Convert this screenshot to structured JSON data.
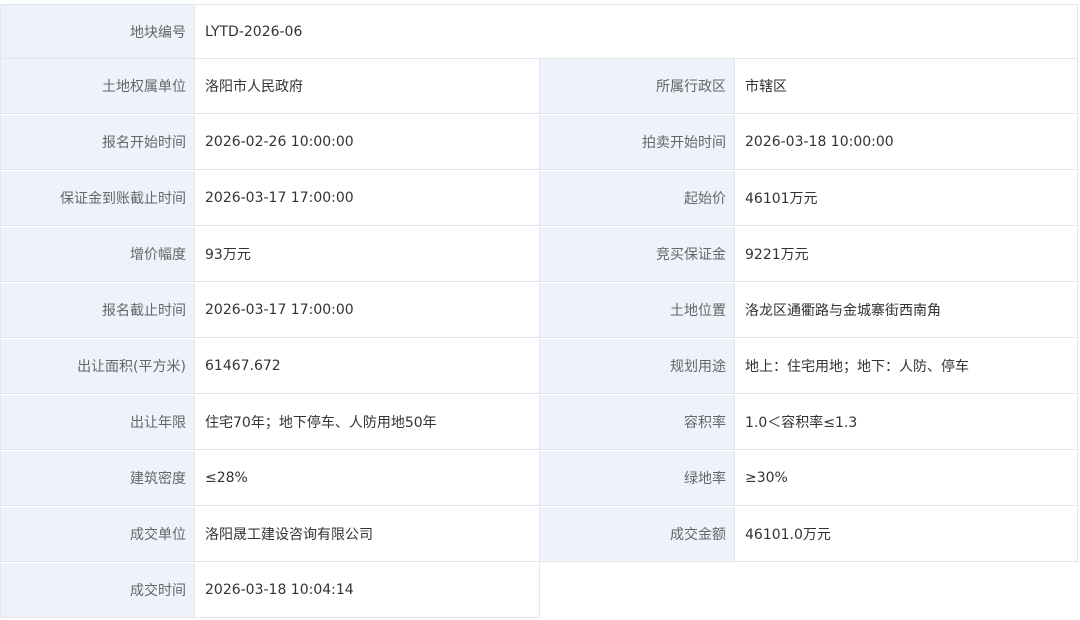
{
  "rows": [
    {
      "label": "地块编号",
      "value": "LYTD-2026-06"
    },
    {
      "label1": "土地权属单位",
      "value1": "洛阳市人民政府",
      "label2": "所属行政区",
      "value2": "市辖区"
    },
    {
      "label1": "报名开始时间",
      "value1": "2026-02-26 10:00:00",
      "label2": "拍卖开始时间",
      "value2": "2026-03-18 10:00:00"
    },
    {
      "label1": "保证金到账截止时间",
      "value1": "2026-03-17 17:00:00",
      "label2": "起始价",
      "value2": "46101万元"
    },
    {
      "label1": "增价幅度",
      "value1": "93万元",
      "label2": "竞买保证金",
      "value2": "9221万元"
    },
    {
      "label1": "报名截止时间",
      "value1": "2026-03-17 17:00:00",
      "label2": "土地位置",
      "value2": "洛龙区通衢路与金城寨街西南角"
    },
    {
      "label1": "出让面积(平方米)",
      "value1": "61467.672",
      "label2": "规划用途",
      "value2": "地上：住宅用地；地下：人防、停车"
    },
    {
      "label1": "出让年限",
      "value1": "住宅70年；地下停车、人防用地50年",
      "label2": "容积率",
      "value2": "1.0＜容积率≤1.3"
    },
    {
      "label1": "建筑密度",
      "value1": "≤28%",
      "label2": "绿地率",
      "value2": "≥30%"
    },
    {
      "label1": "成交单位",
      "value1": "洛阳晟工建设咨询有限公司",
      "label2": "成交金额",
      "value2": "46101.0万元"
    },
    {
      "label1": "成交时间",
      "value1": "2026-03-18 10:04:14"
    }
  ]
}
